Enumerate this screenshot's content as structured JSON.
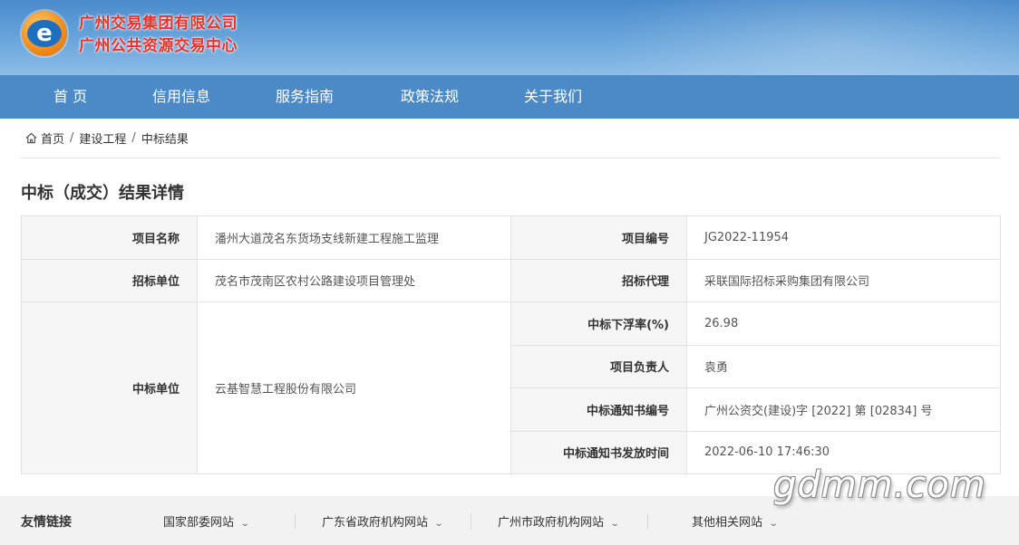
{
  "header": {
    "org_line1": "广州交易集团有限公司",
    "org_line2": "广州公共资源交易中心",
    "logo_letter": "e",
    "logo_icon": "e-logo-icon"
  },
  "nav": {
    "items": [
      {
        "label": "首 页"
      },
      {
        "label": "信用信息"
      },
      {
        "label": "服务指南"
      },
      {
        "label": "政策法规"
      },
      {
        "label": "关于我们"
      }
    ]
  },
  "breadcrumb": {
    "icon": "home-icon",
    "items": [
      "首页",
      "建设工程",
      "中标结果"
    ],
    "separator": "/"
  },
  "page_title": "中标（成交）结果详情",
  "details": {
    "project_name_label": "项目名称",
    "project_name": "潘州大道茂名东货场支线新建工程施工监理",
    "project_no_label": "项目编号",
    "project_no": "JG2022-11954",
    "tender_unit_label": "招标单位",
    "tender_unit": "茂名市茂南区农村公路建设项目管理处",
    "agent_label": "招标代理",
    "agent": "采联国际招标采购集团有限公司",
    "winner_label": "中标单位",
    "winner": "云基智慧工程股份有限公司",
    "discount_label": "中标下浮率(%)",
    "discount": "26.98",
    "manager_label": "项目负责人",
    "manager": "袁勇",
    "notice_no_label": "中标通知书编号",
    "notice_no": "广州公资交(建设)字 [2022] 第 [02834] 号",
    "notice_time_label": "中标通知书发放时间",
    "notice_time": "2022-06-10 17:46:30"
  },
  "footer": {
    "title": "友情链接",
    "links": [
      {
        "label": "国家部委网站"
      },
      {
        "label": "广东省政府机构网站"
      },
      {
        "label": "广州市政府机构网站"
      },
      {
        "label": "其他相关网站"
      }
    ],
    "chevron_icon": "chevron-down-icon"
  },
  "watermark": "gdmm.com",
  "colors": {
    "nav_bg": "#4b8ac7",
    "org_text": "#e8312a",
    "label_bg": "#f5f5f5",
    "footer_bg": "#f2f2f2"
  }
}
